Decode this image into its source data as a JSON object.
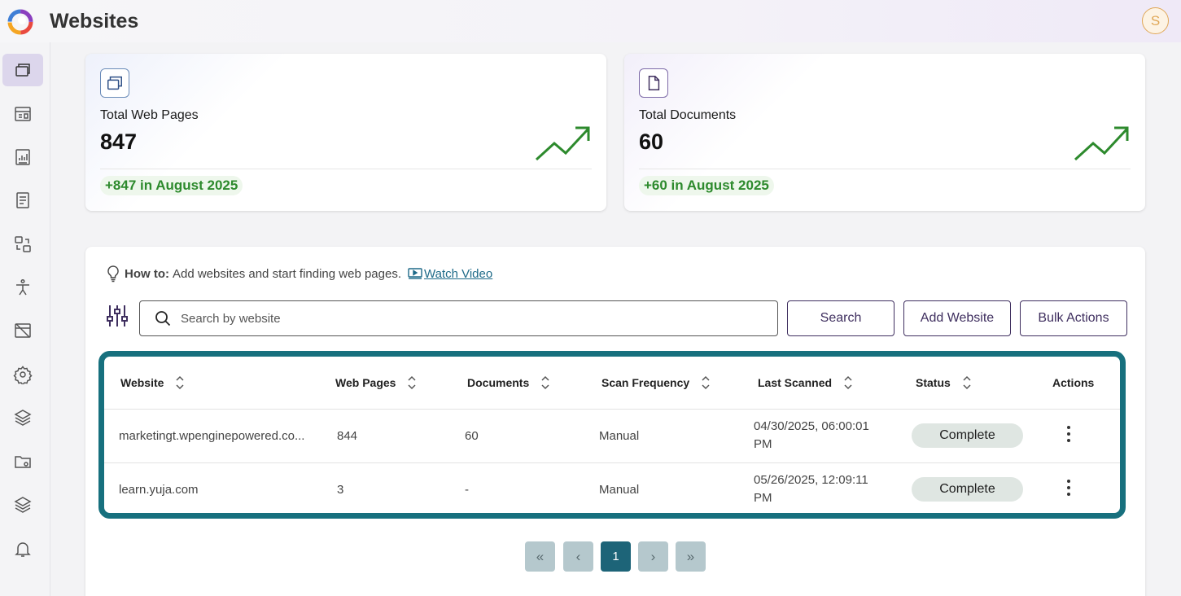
{
  "header": {
    "title": "Websites",
    "avatar_initial": "S"
  },
  "sidebar": {
    "items": [
      {
        "icon": "web-pages-icon",
        "active": true
      },
      {
        "icon": "dashboard-icon",
        "active": false
      },
      {
        "icon": "reports-icon",
        "active": false
      },
      {
        "icon": "document-icon",
        "active": false
      },
      {
        "icon": "workflow-icon",
        "active": false
      },
      {
        "icon": "accessibility-icon",
        "active": false
      },
      {
        "icon": "hidden-window-icon",
        "active": false
      },
      {
        "icon": "settings-icon",
        "active": false
      },
      {
        "icon": "layers-icon",
        "active": false
      },
      {
        "icon": "folder-settings-icon",
        "active": false
      },
      {
        "icon": "layers-alt-icon",
        "active": false
      },
      {
        "icon": "bell-icon",
        "active": false
      }
    ]
  },
  "stats": [
    {
      "icon": "web-pages-icon",
      "label": "Total Web Pages",
      "value": "847",
      "delta": "+847 in August 2025"
    },
    {
      "icon": "document-icon",
      "label": "Total Documents",
      "value": "60",
      "delta": "+60 in August 2025"
    }
  ],
  "howto": {
    "prefix": "How to:",
    "text": "Add websites and start finding web pages.",
    "link": "Watch Video"
  },
  "search": {
    "placeholder": "Search by website",
    "value": ""
  },
  "buttons": {
    "search": "Search",
    "add_website": "Add Website",
    "bulk_actions": "Bulk Actions"
  },
  "table": {
    "columns": [
      "Website",
      "Web Pages",
      "Documents",
      "Scan Frequency",
      "Last Scanned",
      "Status",
      "Actions"
    ],
    "rows": [
      {
        "website": "marketingt.wpenginepowered.co...",
        "web_pages": "844",
        "documents": "60",
        "scan_frequency": "Manual",
        "last_scanned_1": "04/30/2025, 06:00:01",
        "last_scanned_2": "PM",
        "status": "Complete"
      },
      {
        "website": "learn.yuja.com",
        "web_pages": "3",
        "documents": "-",
        "scan_frequency": "Manual",
        "last_scanned_1": "05/26/2025, 12:09:11",
        "last_scanned_2": "PM",
        "status": "Complete"
      }
    ]
  },
  "pagination": {
    "first": "«",
    "prev": "‹",
    "current": "1",
    "next": "›",
    "last": "»"
  },
  "colors": {
    "accent": "#17707e",
    "brand_purple": "#3f2f5f",
    "positive": "#2d8a2d",
    "pager_active": "#1d6478"
  }
}
